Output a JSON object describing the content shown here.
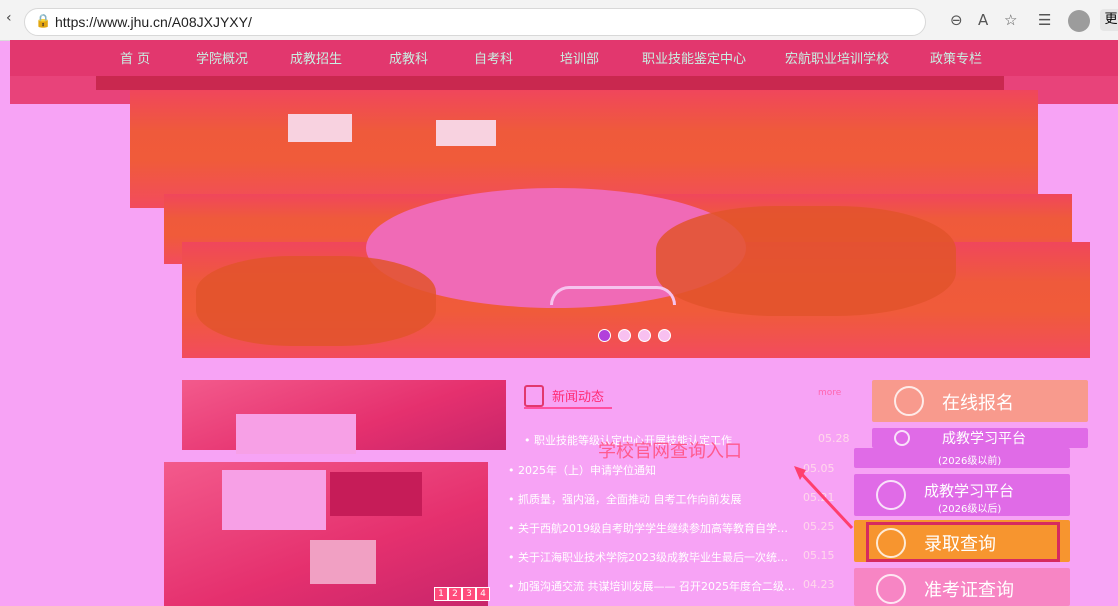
{
  "browser": {
    "url": "https://www.jhu.cn/A08JXJYXY/",
    "profile_initial": "⬤",
    "edge_label": "更"
  },
  "nav": {
    "items": [
      "首 页",
      "学院概况",
      "成教招生",
      "成教科",
      "自考科",
      "培训部",
      "职业技能鉴定中心",
      "宏航职业培训学校",
      "政策专栏"
    ]
  },
  "banner": {
    "slide_count": 4,
    "active_slide": 1
  },
  "news": {
    "title": "新闻动态",
    "more": "more",
    "items": [
      {
        "text": "职业技能等级认定中心开展技能认定工作",
        "date": "05.28"
      },
      {
        "text": "2025年（上）申请学位通知",
        "date": "05.05"
      },
      {
        "text": "抓质量，强内涵，全面推动 自考工作向前发展",
        "date": "05.21"
      },
      {
        "text": "关于西航2019级自考助学学生继续参加高等教育自学…",
        "date": "05.25"
      },
      {
        "text": "关于江海职业技术学院2023级成教毕业生最后一次统…",
        "date": "05.15"
      },
      {
        "text": "加强沟通交流 共谋培训发展—— 召开2025年度合二级…",
        "date": "04.23"
      }
    ]
  },
  "photo_pager": [
    "1",
    "2",
    "3",
    "4"
  ],
  "quick_links": {
    "online_signup": "在线报名",
    "study_platform_a": "成教学习平台",
    "study_platform_a_sub": "(2026级以前)",
    "study_platform_b": "成教学习平台",
    "study_platform_b_sub": "(2026级以后)",
    "admission_query": "录取查询",
    "exam_ticket_query": "准考证查询"
  },
  "annotation": {
    "text": "学校官网查询入口"
  }
}
